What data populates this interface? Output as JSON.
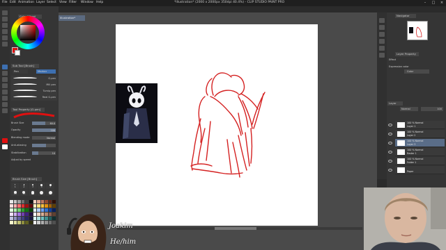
{
  "app": {
    "title": "*Illustration* (2000 x 2000px 350dpi 40.4%) - CLIP STUDIO PAINT PRO"
  },
  "menu": [
    "File",
    "Edit",
    "Animation",
    "Layer",
    "Select",
    "View",
    "Filter",
    "Window",
    "Help"
  ],
  "document_tab": "Illustration*",
  "left_panel": {
    "color_wheel_tab": "Color Wheel",
    "sub_tool_tab": "Sub Tool [Brush]",
    "sub_tool_tabs": [
      "Pen",
      "Marker"
    ],
    "brushes": [
      {
        "label": "G-pen"
      },
      {
        "label": "Mill pen"
      },
      {
        "label": "Turnip pen"
      },
      {
        "label": "Real G-pen"
      }
    ],
    "tool_property_tab": "Tool Property [G-pen]",
    "properties": [
      {
        "label": "Brush Size",
        "value": "60.0",
        "fill": 0.55
      },
      {
        "label": "Opacity",
        "value": "100",
        "fill": 1.0
      },
      {
        "label": "Blending mode",
        "value": "Normal",
        "fill": 0
      },
      {
        "label": "Anti-aliasing",
        "value": "",
        "fill": 0.6
      },
      {
        "label": "Stabilization",
        "value": "10",
        "fill": 0.25
      },
      {
        "label": "Adjust by speed",
        "value": "",
        "fill": 0
      }
    ],
    "brush_size_tab": "Brush Size [Brush]",
    "brush_sizes": [
      "1",
      "2",
      "3",
      "5",
      "7",
      "10",
      "15",
      "20",
      "25",
      "30"
    ]
  },
  "right_panel": {
    "navigator_tab": "Navigator",
    "layer_property_tab": "Layer Property",
    "effect_label": "Effect",
    "expression_color_label": "Expression color",
    "expression_color_value": "Color",
    "layer_tab": "Layer",
    "blend_mode": "Normal",
    "opacity": "100",
    "layers": [
      {
        "line1": "100 % Normal",
        "line2": "Layer 1",
        "selected": false
      },
      {
        "line1": "100 % Normal",
        "line2": "Layer 2",
        "selected": false
      },
      {
        "line1": "100 % Normal",
        "line2": "Layer 3",
        "selected": true
      },
      {
        "line1": "100 % Normal",
        "line2": "Raster 1",
        "selected": false
      },
      {
        "line1": "100 % Normal",
        "line2": "Folder 1",
        "selected": false
      },
      {
        "line1": "",
        "line2": "Paper",
        "selected": false
      }
    ]
  },
  "overlay": {
    "name": "Joakim",
    "pronouns": "He/him"
  },
  "colors": {
    "accent": "#3d6fb0",
    "stroke": "#d42020",
    "selected_layer": "#5a6d88"
  },
  "palette": [
    "#e8e8e8",
    "#c8c8c8",
    "#a0a0a0",
    "#707070",
    "#404040",
    "#101010",
    "#f4d0c0",
    "#e0a890",
    "#c07860",
    "#904830",
    "#602818",
    "#301008",
    "#ffe0e0",
    "#ffb0b0",
    "#ff7070",
    "#e03030",
    "#a01010",
    "#600808",
    "#fff0c0",
    "#ffe080",
    "#ffc040",
    "#e09010",
    "#a06008",
    "#604004",
    "#e0ffe0",
    "#b0f0b0",
    "#70d070",
    "#30a030",
    "#107010",
    "#084008",
    "#e0f0ff",
    "#b0d0ff",
    "#70a0f0",
    "#3070d0",
    "#1040a0",
    "#082060",
    "#f0e0ff",
    "#d0b0f0",
    "#a070e0",
    "#7040b0",
    "#402080",
    "#201040",
    "#ffffff",
    "#f0d8c8",
    "#d8b098",
    "#b88870",
    "#906050",
    "#604030",
    "#c0c0e0",
    "#9090c0",
    "#6060a0",
    "#404080",
    "#282860",
    "#181840",
    "#d8f8f8",
    "#a8e0e0",
    "#70c0c0",
    "#409090",
    "#206060",
    "#103030",
    "#f8f8d0",
    "#e0e0a0",
    "#c0c070",
    "#909040",
    "#606020",
    "#303010",
    "#f0f0f0",
    "#d0d0d0",
    "#b0b0b0",
    "#909090",
    "#707070",
    "#505050"
  ]
}
